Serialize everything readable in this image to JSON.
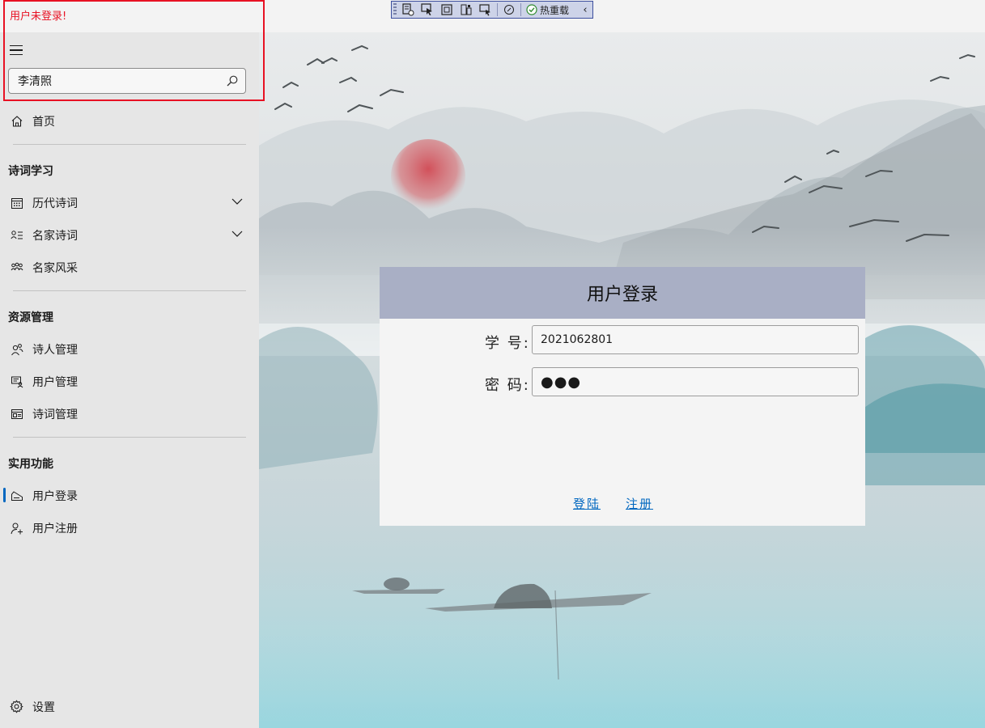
{
  "window": {
    "status_text": "用户未登录!"
  },
  "devtools": {
    "hot_reload_label": "热重载"
  },
  "sidebar": {
    "search": {
      "value": "李清照"
    },
    "home": {
      "label": "首页"
    },
    "sections": [
      {
        "header": "诗词学习",
        "items": [
          {
            "label": "历代诗词",
            "icon": "calendar-icon",
            "expandable": true
          },
          {
            "label": "名家诗词",
            "icon": "contact-list-icon",
            "expandable": true
          },
          {
            "label": "名家风采",
            "icon": "people-icon",
            "expandable": false
          }
        ]
      },
      {
        "header": "资源管理",
        "items": [
          {
            "label": "诗人管理",
            "icon": "person-group-icon",
            "expandable": false
          },
          {
            "label": "用户管理",
            "icon": "user-card-icon",
            "expandable": false
          },
          {
            "label": "诗词管理",
            "icon": "document-icon",
            "expandable": false
          }
        ]
      },
      {
        "header": "实用功能",
        "items": [
          {
            "label": "用户登录",
            "icon": "signin-icon",
            "expandable": false,
            "selected": true
          },
          {
            "label": "用户注册",
            "icon": "add-user-icon",
            "expandable": false
          }
        ]
      }
    ],
    "settings": {
      "label": "设置"
    }
  },
  "login": {
    "title": "用户登录",
    "id_label": "学 号:",
    "id_value": "2021062801",
    "password_label": "密 码:",
    "password_value": "●●●",
    "login_link": "登陆",
    "register_link": "注册"
  },
  "colors": {
    "accent": "#0067c0",
    "status_red": "#e81123",
    "card_header": "#a9afc5"
  }
}
